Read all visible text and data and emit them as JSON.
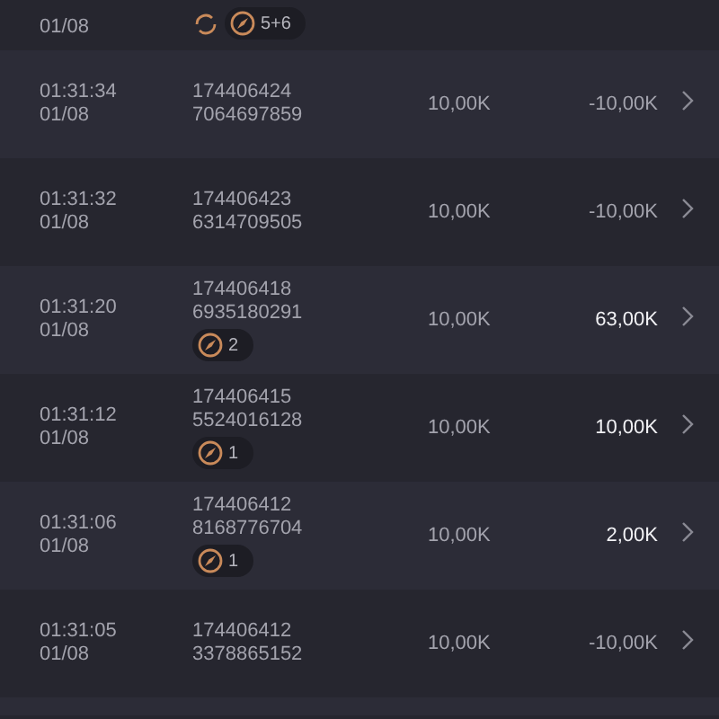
{
  "rows": [
    {
      "date": "01/08",
      "badges": [
        {
          "kind": "refresh"
        },
        {
          "kind": "tag",
          "text": "5+6"
        }
      ]
    },
    {
      "time": "01:31:34",
      "date": "01/08",
      "id_line_1": "174406424",
      "id_line_2": "7064697859",
      "amount": "10,00K",
      "result": "-10,00K",
      "positive": false
    },
    {
      "time": "01:31:32",
      "date": "01/08",
      "id_line_1": "174406423",
      "id_line_2": "6314709505",
      "amount": "10,00K",
      "result": "-10,00K",
      "positive": false
    },
    {
      "time": "01:31:20",
      "date": "01/08",
      "id_line_1": "174406418",
      "id_line_2": "6935180291",
      "badges": [
        {
          "kind": "tag",
          "text": "2"
        }
      ],
      "amount": "10,00K",
      "result": "63,00K",
      "positive": true
    },
    {
      "time": "01:31:12",
      "date": "01/08",
      "id_line_1": "174406415",
      "id_line_2": "5524016128",
      "badges": [
        {
          "kind": "tag",
          "text": "1"
        }
      ],
      "amount": "10,00K",
      "result": "10,00K",
      "positive": true
    },
    {
      "time": "01:31:06",
      "date": "01/08",
      "id_line_1": "174406412",
      "id_line_2": "8168776704",
      "badges": [
        {
          "kind": "tag",
          "text": "1"
        }
      ],
      "amount": "10,00K",
      "result": "2,00K",
      "positive": true
    },
    {
      "time": "01:31:05",
      "date": "01/08",
      "id_line_1": "174406412",
      "id_line_2": "3378865152",
      "amount": "10,00K",
      "result": "-10,00K",
      "positive": false
    }
  ]
}
